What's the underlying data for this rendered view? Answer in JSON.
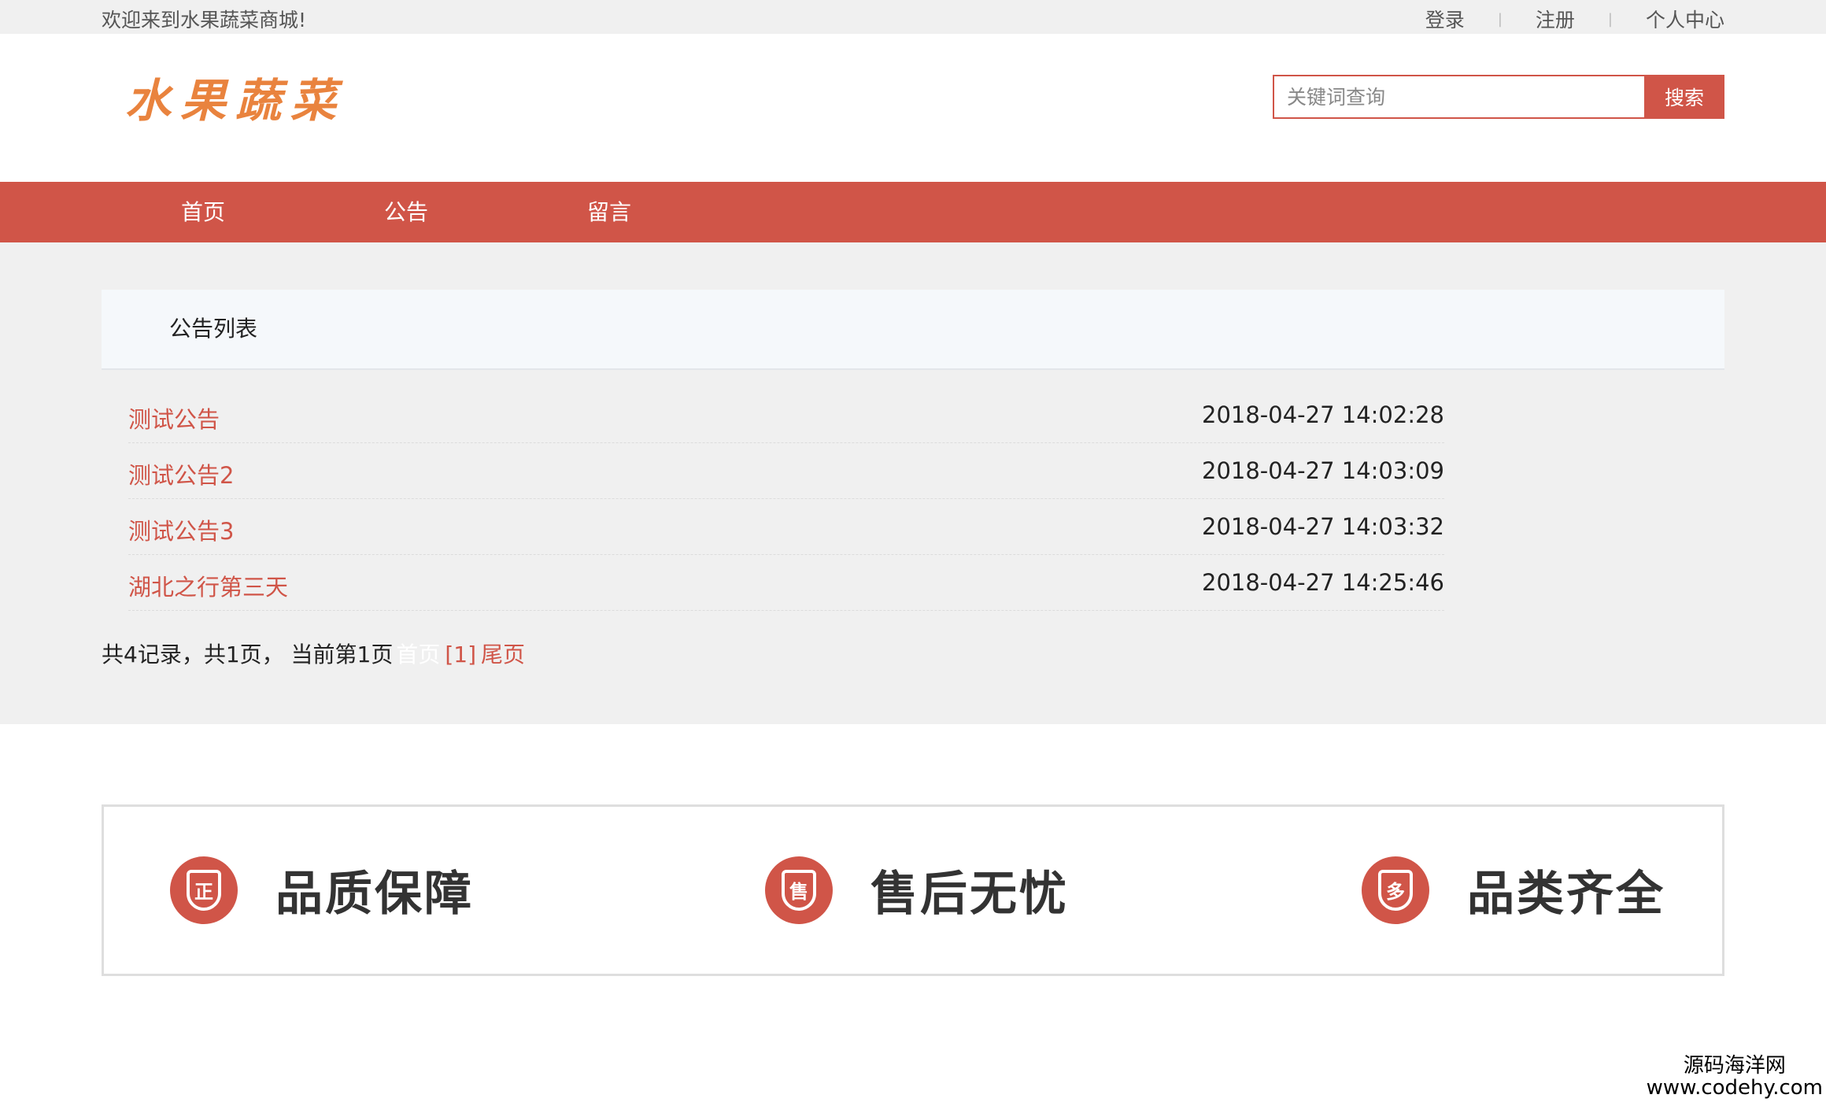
{
  "topbar": {
    "welcome": "欢迎来到水果蔬菜商城!",
    "links": [
      "登录",
      "注册",
      "个人中心"
    ]
  },
  "header": {
    "logo": "水果蔬菜",
    "search_placeholder": "关键词查询",
    "search_button": "搜索"
  },
  "nav": {
    "items": [
      "首页",
      "公告",
      "留言"
    ]
  },
  "notice_panel": {
    "title": "公告列表",
    "rows": [
      {
        "title": "测试公告",
        "time": "2018-04-27 14:02:28"
      },
      {
        "title": "测试公告2",
        "time": "2018-04-27 14:03:09"
      },
      {
        "title": "测试公告3",
        "time": "2018-04-27 14:03:32"
      },
      {
        "title": "湖北之行第三天",
        "time": "2018-04-27 14:25:46"
      }
    ]
  },
  "pager": {
    "summary": "共4记录，共1页， 当前第1页",
    "first": "首页",
    "page": "[1]",
    "last": "尾页"
  },
  "features": [
    {
      "badge": "正",
      "label": "品质保障"
    },
    {
      "badge": "售",
      "label": "售后无忧"
    },
    {
      "badge": "多",
      "label": "品类齐全"
    }
  ],
  "watermark": {
    "line1": "源码海洋网",
    "line2": "www.codehy.com"
  },
  "colors": {
    "accent": "#d05548",
    "logo": "#e9833e",
    "gray_bg": "#f0f0f0"
  }
}
